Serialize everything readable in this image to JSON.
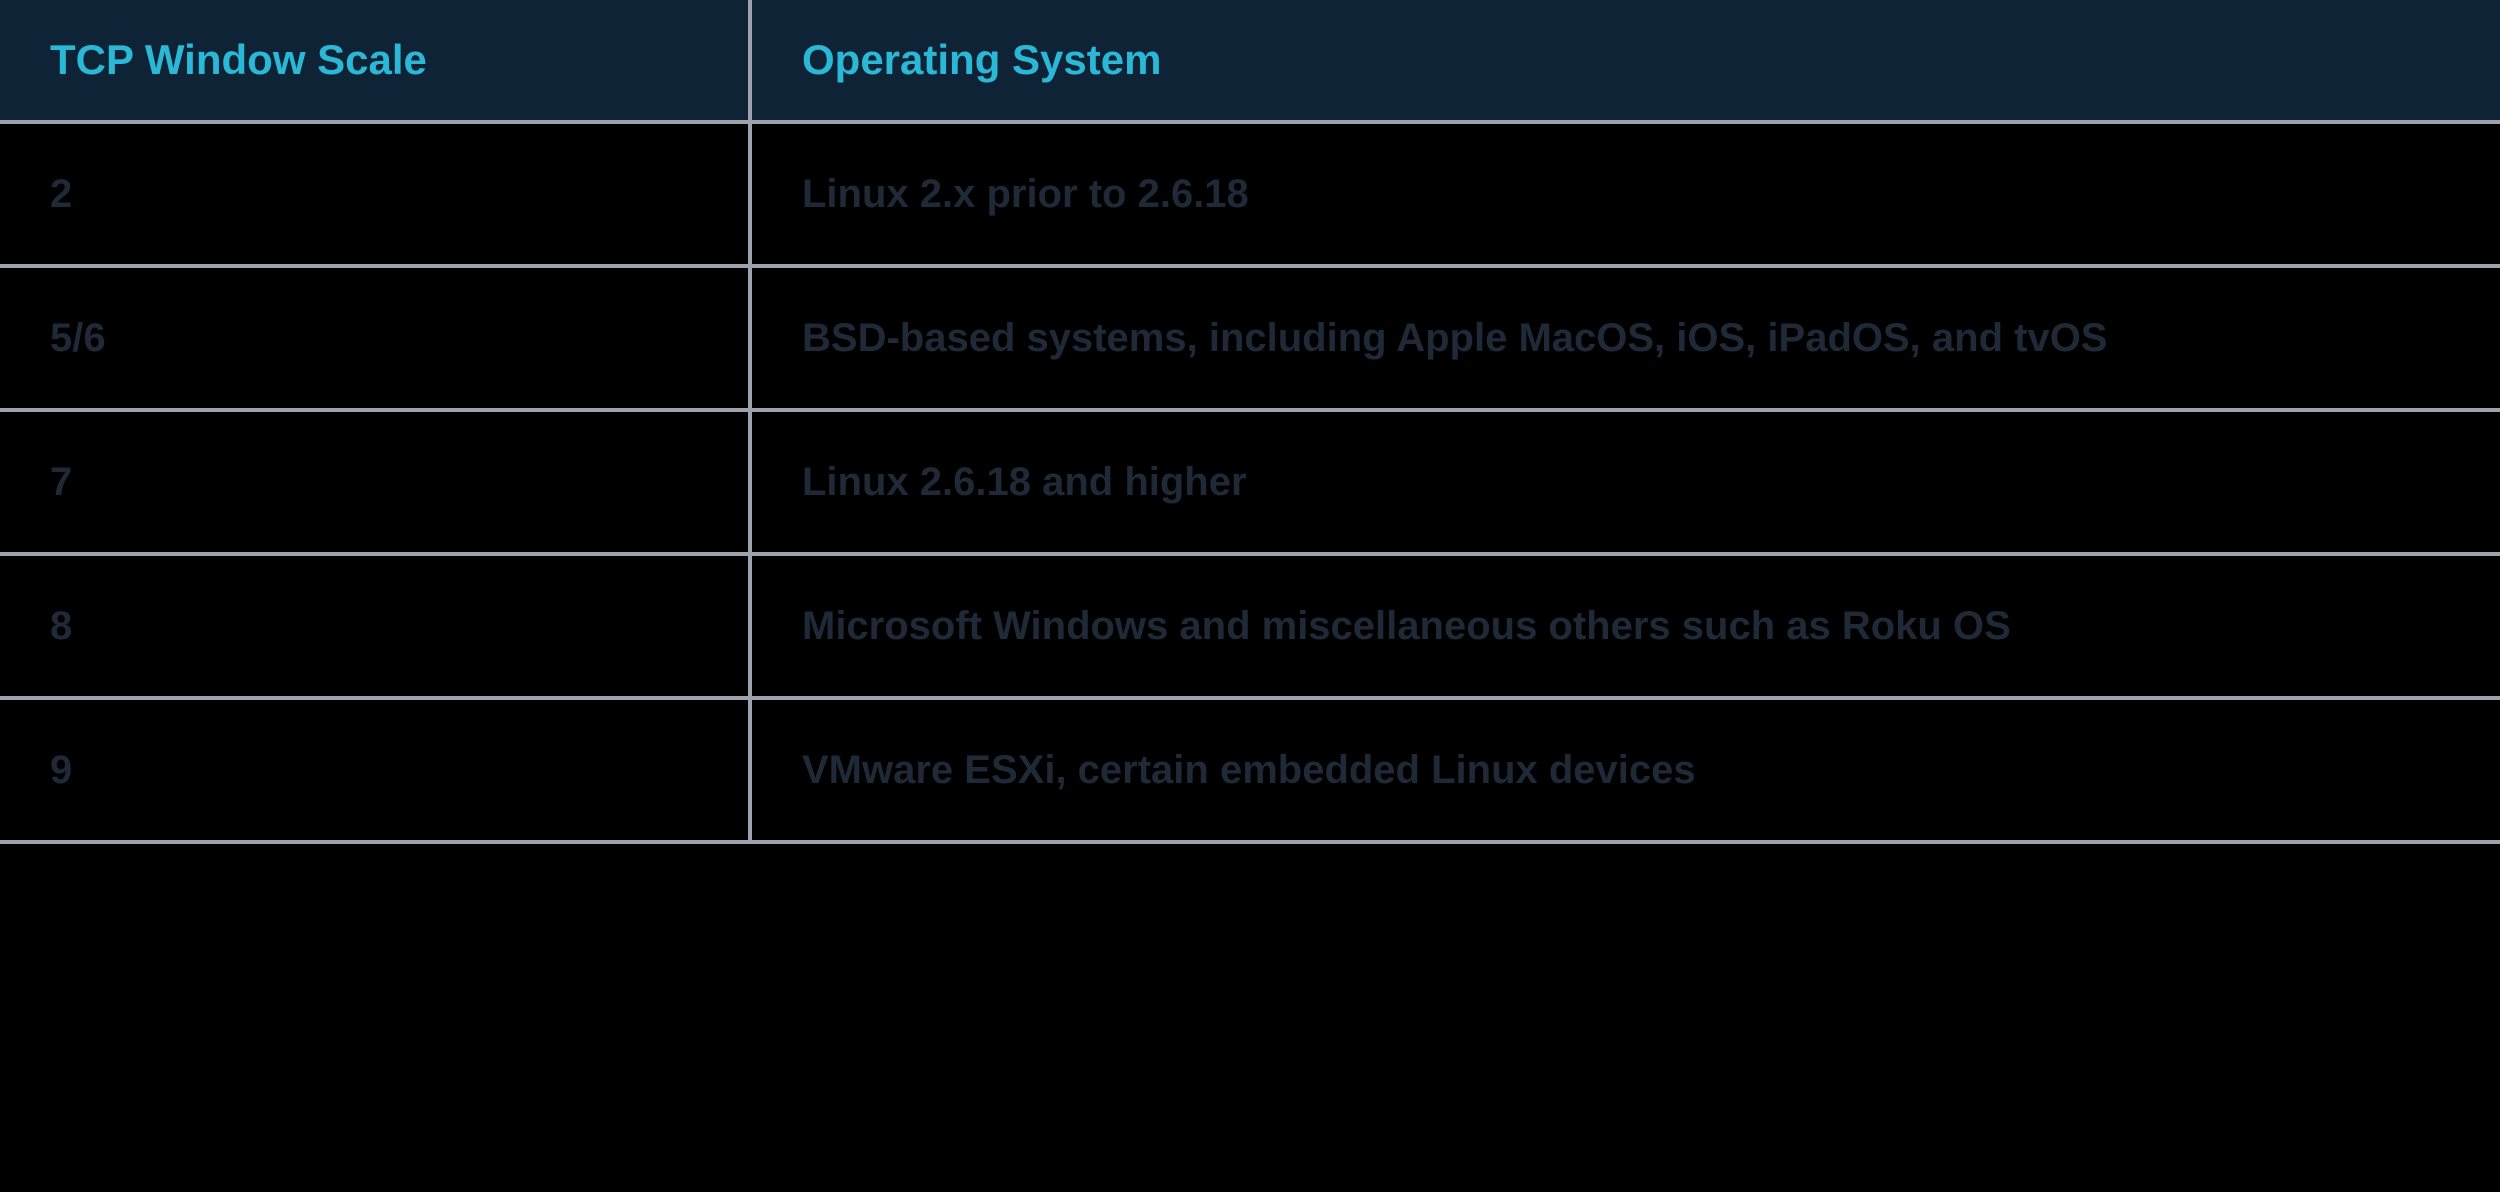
{
  "chart_data": {
    "type": "table",
    "columns": [
      "TCP Window Scale",
      "Operating System"
    ],
    "rows": [
      {
        "scale": "2",
        "os": "Linux 2.x prior to 2.6.18"
      },
      {
        "scale": "5/6",
        "os": "BSD-based systems, including Apple MacOS, iOS, iPadOS, and tvOS"
      },
      {
        "scale": "7",
        "os": "Linux 2.6.18 and higher"
      },
      {
        "scale": "8",
        "os": "Microsoft Windows and miscellaneous others such as Roku OS"
      },
      {
        "scale": "9",
        "os": "VMware ESXi, certain embedded Linux devices"
      }
    ]
  },
  "table": {
    "headers": {
      "col1": "TCP Window Scale",
      "col2": "Operating System"
    },
    "rows": [
      {
        "scale": "2",
        "os": "Linux 2.x prior to 2.6.18"
      },
      {
        "scale": "5/6",
        "os": "BSD-based systems, including Apple MacOS, iOS, iPadOS, and tvOS"
      },
      {
        "scale": "7",
        "os": "Linux 2.6.18 and higher"
      },
      {
        "scale": "8",
        "os": "Microsoft Windows and miscellaneous others such as Roku OS"
      },
      {
        "scale": "9",
        "os": "VMware ESXi, certain embedded Linux devices"
      }
    ]
  },
  "colors": {
    "header_bg": "#0e2436",
    "header_text": "#2bb8d6",
    "cell_bg": "#000000",
    "cell_text": "#1f2937",
    "border": "#9ca3af"
  }
}
